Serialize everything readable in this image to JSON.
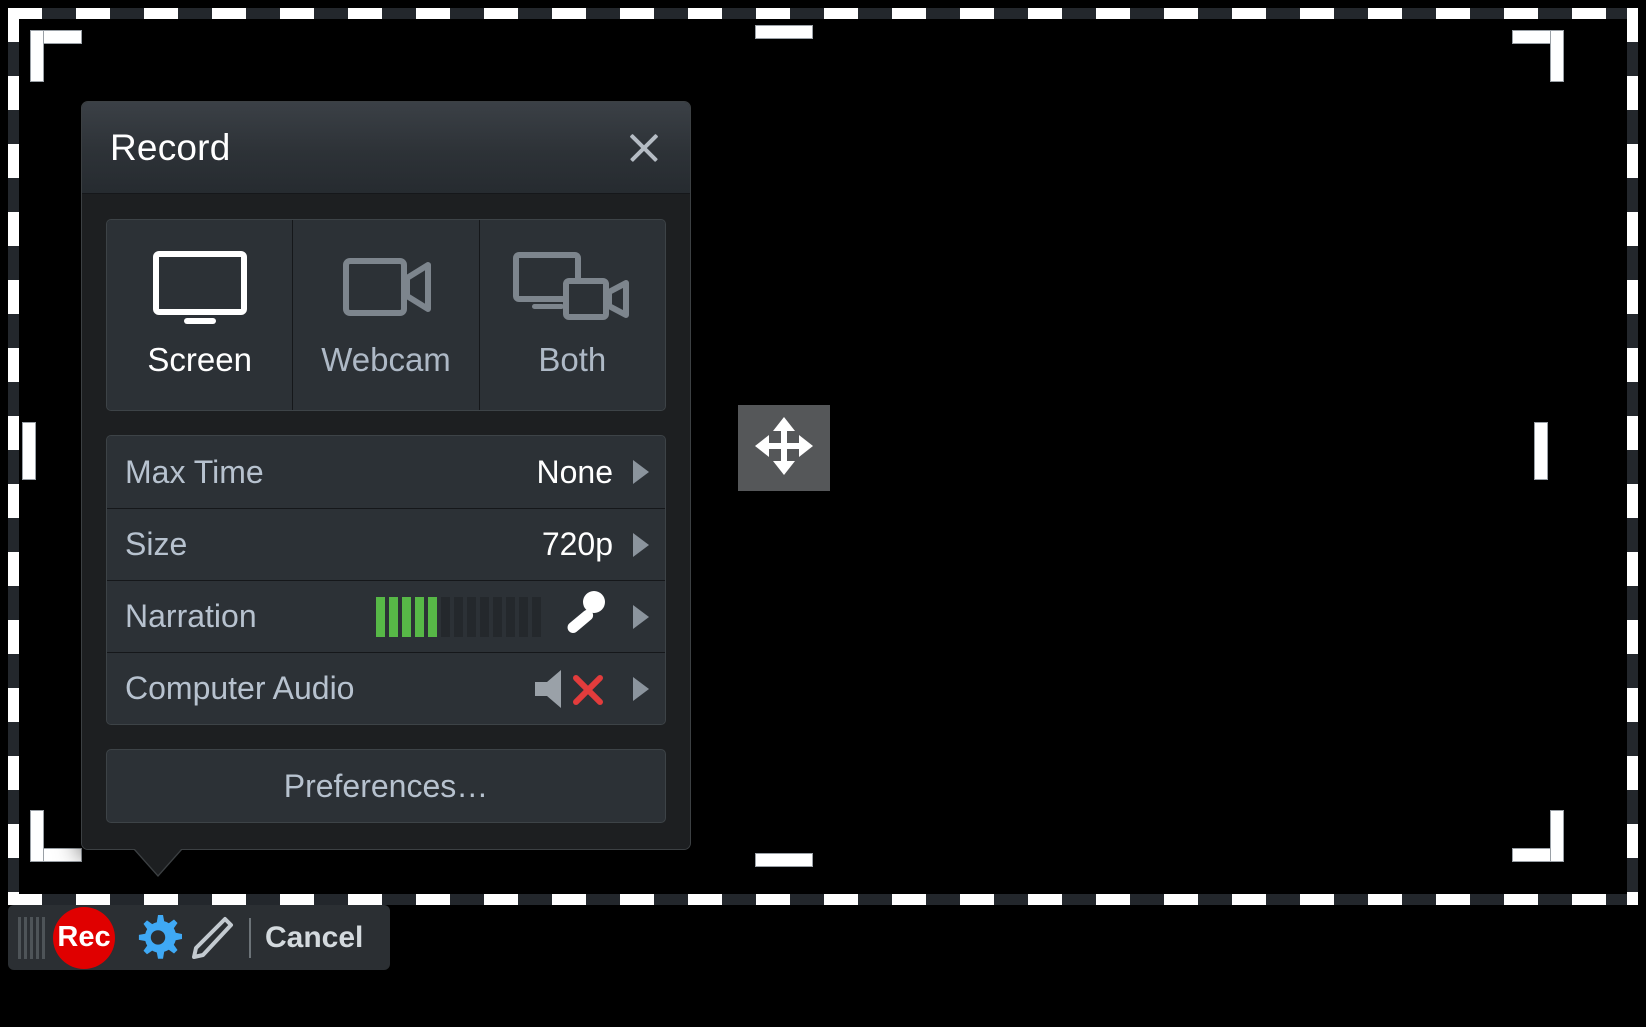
{
  "selection": {
    "move_handle_icon": "move-four-arrows-icon",
    "handles": [
      "top-center",
      "bottom-center",
      "left-middle",
      "right-middle"
    ],
    "corner_brackets": [
      "top-left",
      "top-right",
      "bottom-left",
      "bottom-right"
    ]
  },
  "popover": {
    "title": "Record",
    "close_icon": "close-x-icon",
    "modes": [
      {
        "label": "Screen",
        "icon": "monitor-icon",
        "selected": true
      },
      {
        "label": "Webcam",
        "icon": "video-camera-icon",
        "selected": false
      },
      {
        "label": "Both",
        "icon": "monitor-plus-camera-icon",
        "selected": false
      }
    ],
    "settings": [
      {
        "label": "Max Time",
        "value": "None",
        "chevron_icon": "chevron-right-icon"
      },
      {
        "label": "Size",
        "value": "720p",
        "chevron_icon": "chevron-right-icon"
      },
      {
        "label": "Narration",
        "value": "",
        "chevron_icon": "chevron-right-icon",
        "meter": {
          "total_bars": 13,
          "active_bars": 5,
          "active_color": "#57b847",
          "inactive_color": "#24282c"
        },
        "device_icon": "microphone-icon"
      },
      {
        "label": "Computer Audio",
        "value": "",
        "chevron_icon": "chevron-right-icon",
        "device_icon": "speaker-muted-icon",
        "muted": true,
        "mute_mark_color": "#e23c3c"
      }
    ],
    "preferences_label": "Preferences…"
  },
  "toolbar": {
    "drag_handle_icon": "drag-grip-icon",
    "record_label": "Rec",
    "settings_icon": "gear-icon",
    "annotate_icon": "pencil-icon",
    "cancel_label": "Cancel"
  },
  "colors": {
    "record_red": "#e00000",
    "gear_blue": "#3fa9f5",
    "accent_green": "#57b847",
    "mute_red": "#e23c3c",
    "panel_bg": "#1d1f21",
    "row_bg": "#2c3136"
  }
}
